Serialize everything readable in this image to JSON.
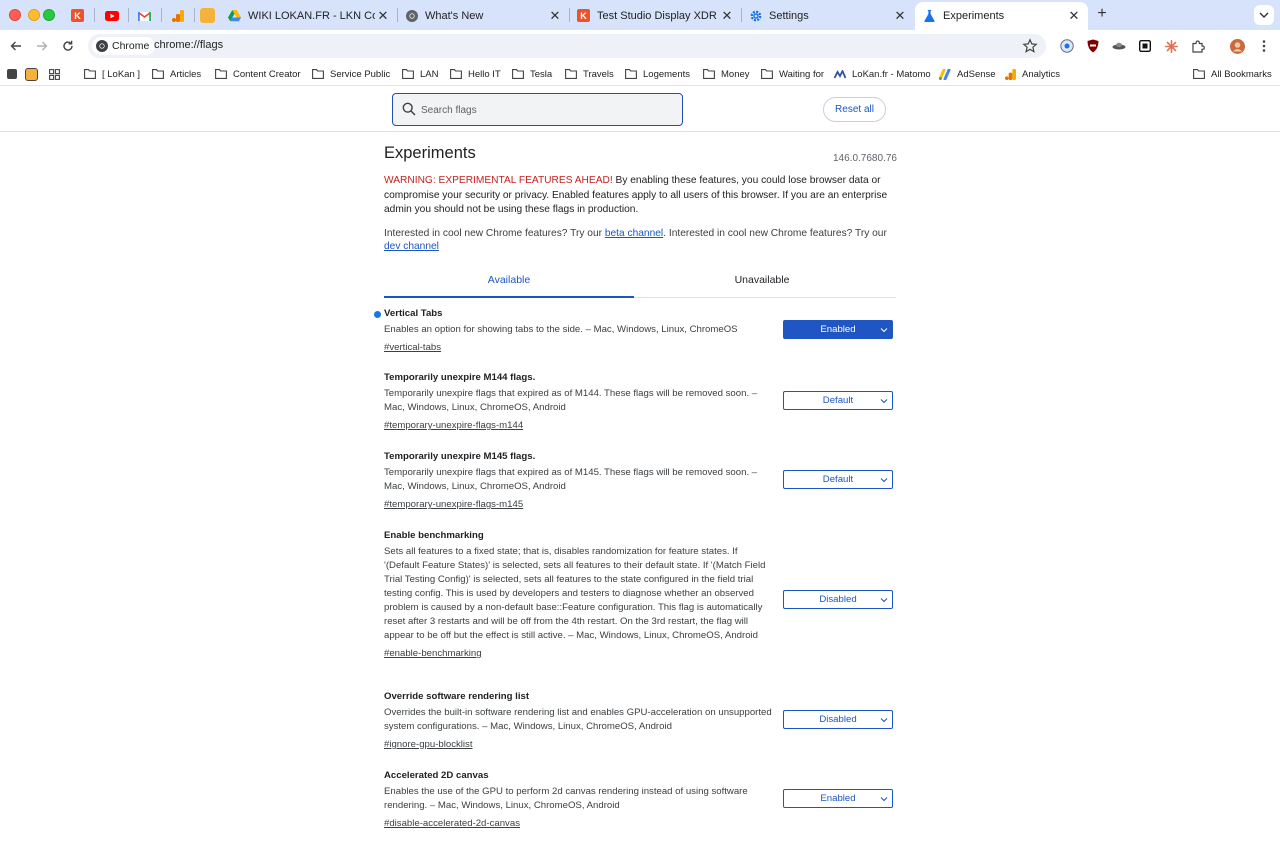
{
  "browser": {
    "tabs": [
      {
        "title": "WIKI LOKAN.FR - LKN Corp.",
        "icon": "google-drive-icon"
      },
      {
        "title": "What's New",
        "icon": "chrome-icon"
      },
      {
        "title": "Test Studio Display XDR : vau",
        "icon": "k-icon"
      },
      {
        "title": "Settings",
        "icon": "gear-icon"
      },
      {
        "title": "Experiments",
        "icon": "flask-icon",
        "active": true
      }
    ],
    "omnibox": {
      "chip_label": "Chrome",
      "url": "chrome://flags"
    }
  },
  "bookmarks": {
    "items": [
      "[ LoKan ]",
      "Articles",
      "Content Creator",
      "Service Public",
      "LAN",
      "Hello IT",
      "Tesla",
      "Travels",
      "Logements",
      "Money",
      "Waiting for",
      "LoKan.fr - Matomo",
      "AdSense",
      "Analytics"
    ],
    "all_bookmarks": "All Bookmarks"
  },
  "flags_page": {
    "search_placeholder": "Search flags",
    "reset_label": "Reset all",
    "title": "Experiments",
    "version": "146.0.7680.76",
    "warning_red": "WARNING: EXPERIMENTAL FEATURES AHEAD!",
    "warning_rest": " By enabling these features, you could lose browser data or compromise your security or privacy. Enabled features apply to all users of this browser. If you are an enterprise admin you should not be using these flags in production.",
    "interest_prefix": "Interested in cool new Chrome features? Try our ",
    "beta_link": "beta channel",
    "interest_middle": ". Interested in cool new Chrome features? Try our ",
    "dev_link": "dev channel",
    "tab_available": "Available",
    "tab_unavailable": "Unavailable",
    "flags": [
      {
        "name": "Vertical Tabs",
        "description": "Enables an option for showing tabs to the side. – Mac, Windows, Linux, ChromeOS",
        "link": "#vertical-tabs",
        "state": "Enabled"
      },
      {
        "name": "Temporarily unexpire M144 flags.",
        "description": "Temporarily unexpire flags that expired as of M144. These flags will be removed soon. – Mac, Windows, Linux, ChromeOS, Android",
        "link": "#temporary-unexpire-flags-m144",
        "state": "Default"
      },
      {
        "name": "Temporarily unexpire M145 flags.",
        "description": "Temporarily unexpire flags that expired as of M145. These flags will be removed soon. – Mac, Windows, Linux, ChromeOS, Android",
        "link": "#temporary-unexpire-flags-m145",
        "state": "Default"
      },
      {
        "name": "Enable benchmarking",
        "description": "Sets all features to a fixed state; that is, disables randomization for feature states. If '(Default Feature States)' is selected, sets all features to their default state. If '(Match Field Trial Testing Config)' is selected, sets all features to the state configured in the field trial testing config. This is used by developers and testers to diagnose whether an observed problem is caused by a non-default base::Feature configuration. This flag is automatically reset after 3 restarts and will be off from the 4th restart. On the 3rd restart, the flag will appear to be off but the effect is still active. – Mac, Windows, Linux, ChromeOS, Android",
        "link": "#enable-benchmarking",
        "state": "Disabled"
      },
      {
        "name": "Override software rendering list",
        "description": "Overrides the built-in software rendering list and enables GPU-acceleration on unsupported system configurations. – Mac, Windows, Linux, ChromeOS, Android",
        "link": "#ignore-gpu-blocklist",
        "state": "Disabled"
      },
      {
        "name": "Accelerated 2D canvas",
        "description": "Enables the use of the GPU to perform 2d canvas rendering instead of using software rendering. – Mac, Windows, Linux, ChromeOS, Android",
        "link": "#disable-accelerated-2d-canvas",
        "state": "Enabled"
      }
    ]
  }
}
